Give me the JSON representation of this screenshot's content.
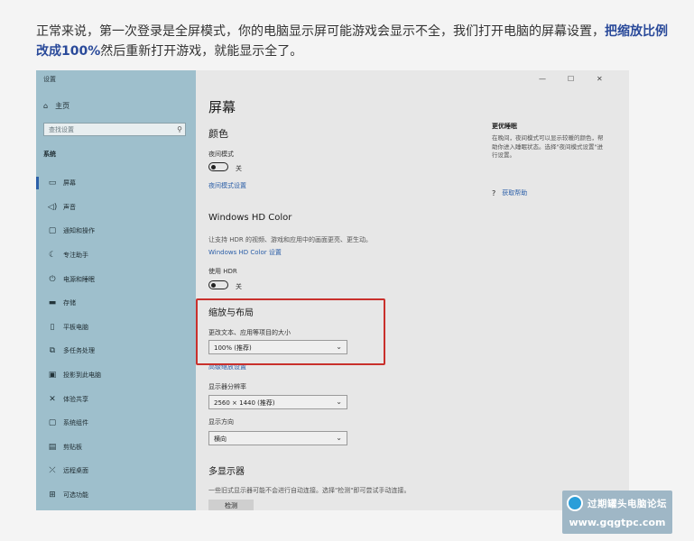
{
  "article": {
    "text_before": "正常来说，第一次登录是全屏模式，你的电脑显示屏可能游戏会显示不全，我们打开电脑的屏幕设置，",
    "highlight": "把缩放比例改成100%",
    "text_after": "然后重新打开游戏，就能显示全了。"
  },
  "settings": {
    "window_title": "设置",
    "window_controls": {
      "minimize": "—",
      "maximize": "☐",
      "close": "✕"
    },
    "sidebar": {
      "home_label": "主页",
      "search_placeholder": "查找设置",
      "section_label": "系统",
      "items": [
        {
          "label": "屏幕",
          "icon": "monitor-icon",
          "glyph": "▭"
        },
        {
          "label": "声音",
          "icon": "speaker-icon",
          "glyph": "◁)"
        },
        {
          "label": "通知和操作",
          "icon": "notification-icon",
          "glyph": "▢"
        },
        {
          "label": "专注助手",
          "icon": "moon-icon",
          "glyph": "☾"
        },
        {
          "label": "电源和睡眠",
          "icon": "power-icon",
          "glyph": "⏻"
        },
        {
          "label": "存储",
          "icon": "storage-icon",
          "glyph": "▬"
        },
        {
          "label": "平板电脑",
          "icon": "tablet-icon",
          "glyph": "▯"
        },
        {
          "label": "多任务处理",
          "icon": "multitask-icon",
          "glyph": "⧉"
        },
        {
          "label": "投影到此电脑",
          "icon": "projector-icon",
          "glyph": "▣"
        },
        {
          "label": "体验共享",
          "icon": "share-icon",
          "glyph": "✕"
        },
        {
          "label": "系统组件",
          "icon": "components-icon",
          "glyph": "▢"
        },
        {
          "label": "剪贴板",
          "icon": "clipboard-icon",
          "glyph": "▤"
        },
        {
          "label": "远程桌面",
          "icon": "remote-icon",
          "glyph": "⤫"
        },
        {
          "label": "可选功能",
          "icon": "features-icon",
          "glyph": "⊞"
        }
      ]
    },
    "main": {
      "title": "屏幕",
      "color_heading": "颜色",
      "night_light_label": "夜间模式",
      "night_light_state": "关",
      "night_light_link": "夜间模式设置",
      "hdr_heading": "Windows HD Color",
      "hdr_desc": "让支持 HDR 的视频、游戏和应用中的画面更亮、更生动。",
      "hdr_link": "Windows HD Color 设置",
      "use_hdr_label": "使用 HDR",
      "use_hdr_state": "关",
      "scale_heading": "缩放与布局",
      "scale_label": "更改文本、应用等项目的大小",
      "scale_value": "100% (推荐)",
      "advanced_scale_link": "高级缩放设置",
      "resolution_label": "显示器分辨率",
      "resolution_value": "2560 × 1440 (推荐)",
      "orientation_label": "显示方向",
      "orientation_value": "横向",
      "multi_heading": "多显示器",
      "multi_desc": "一些旧式显示器可能不会进行自动连接。选择\"检测\"即可尝试手动连接。",
      "detect_button": "检测"
    },
    "right_panel": {
      "title": "更优睡眠",
      "desc": "在晚间，夜间模式可以显示较暖的颜色，帮助你进入睡眠状态。选择\"夜间模式设置\"进行设置。",
      "help_link": "获取帮助"
    }
  },
  "watermark": {
    "name": "过期罐头电脑论坛",
    "url": "www.gqgtpc.com"
  }
}
